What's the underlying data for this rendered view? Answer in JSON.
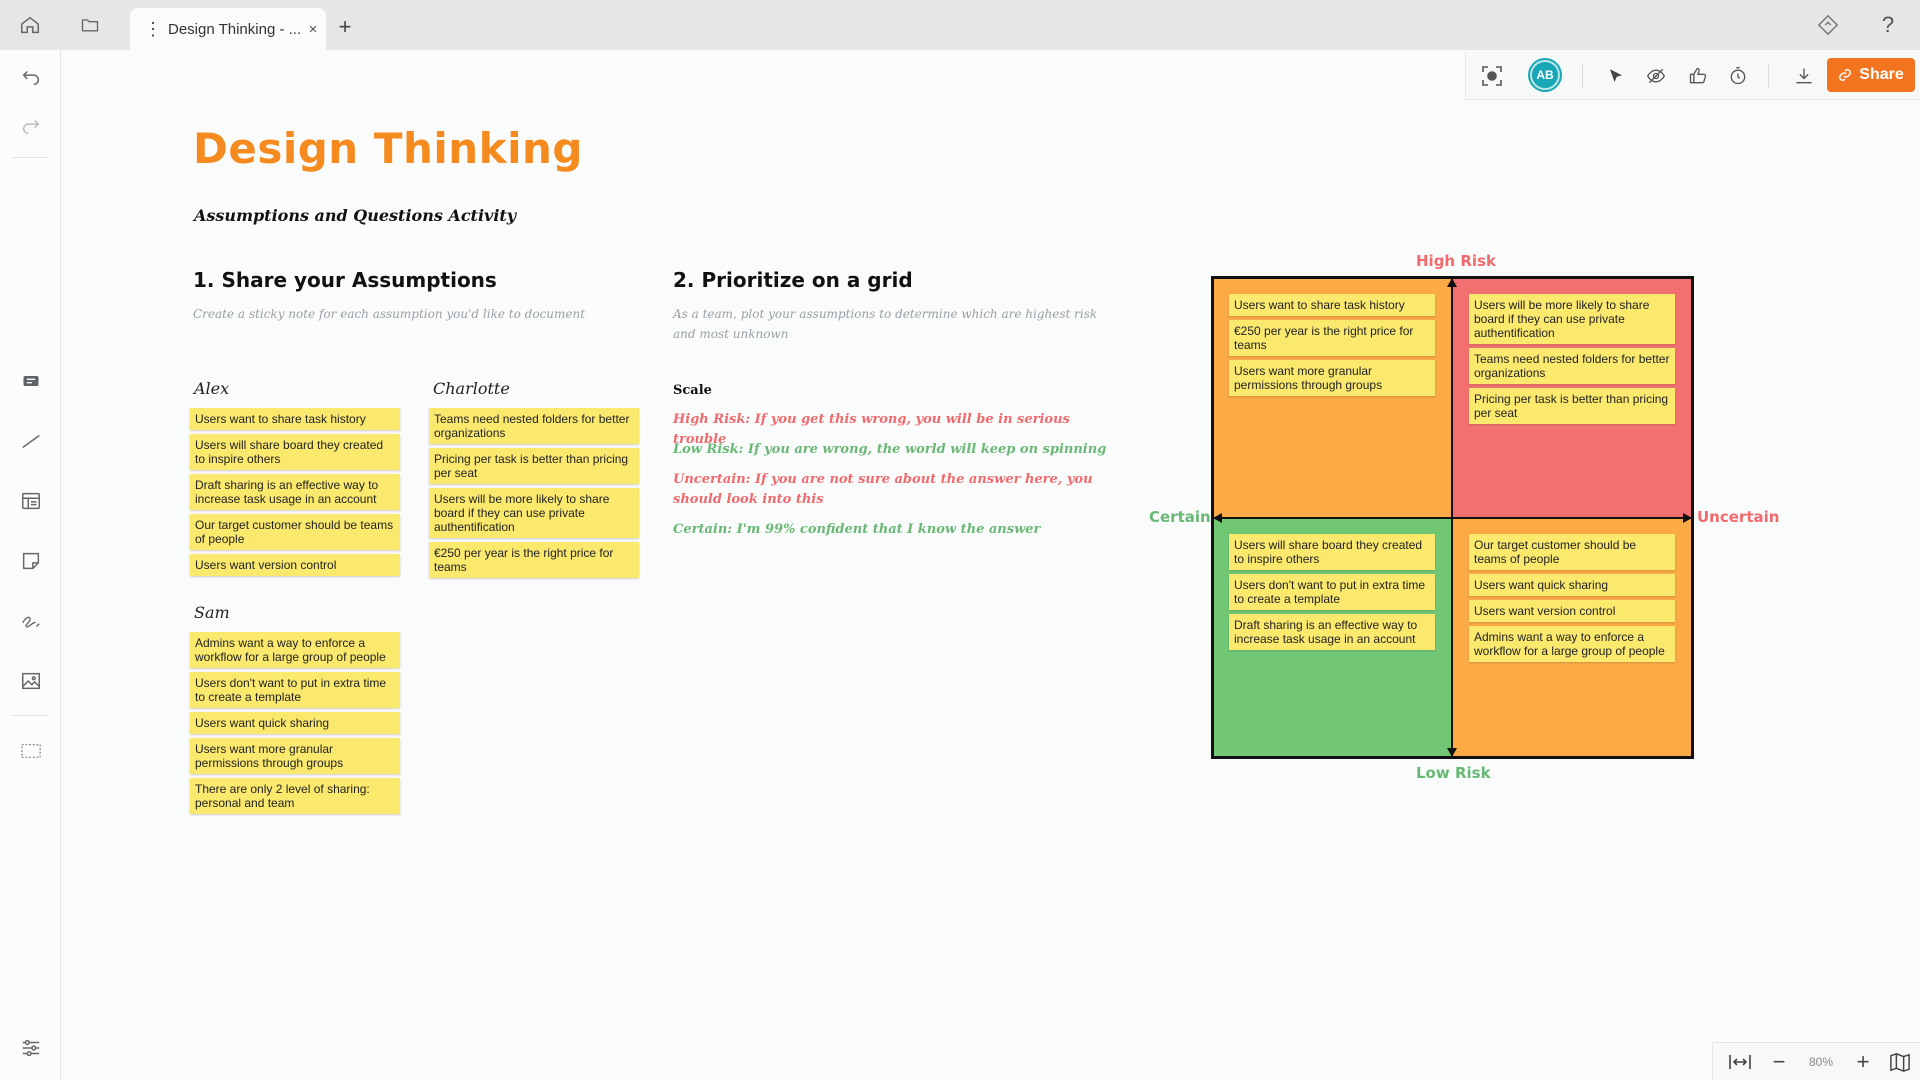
{
  "tab": {
    "title": "Design Thinking - ...",
    "close": "×",
    "new_tab": "+"
  },
  "toolbar": {
    "avatar_initials": "AB",
    "share_label": "Share"
  },
  "page": {
    "title": "Design Thinking",
    "subtitle": "Assumptions and Questions Activity"
  },
  "section1": {
    "title": "1. Share your Assumptions",
    "description": "Create a sticky note for each assumption you'd like to document"
  },
  "section2": {
    "title": "2. Prioritize on a grid",
    "description": "As a team, plot your assumptions to determine which are highest risk and most unknown"
  },
  "people": {
    "alex": {
      "name": "Alex",
      "notes": [
        "Users want to share task history",
        "Users will share board they created to inspire others",
        "Draft sharing is an effective way to increase task usage in an account",
        "Our target customer should be teams of people",
        "Users want version control"
      ]
    },
    "charlotte": {
      "name": "Charlotte",
      "notes": [
        "Teams need nested folders for better organizations",
        "Pricing per task is better than pricing per seat",
        "Users will be more likely to share board if they can use private authentification",
        "€250 per year is the right price for teams"
      ]
    },
    "sam": {
      "name": "Sam",
      "notes": [
        "Admins want a way to enforce a workflow for a large group of people",
        "Users don't want to put in extra time to create a template",
        "Users want quick sharing",
        "Users want more granular permissions through groups",
        "There are only 2 level of sharing: personal and team"
      ]
    }
  },
  "scale": {
    "label": "Scale",
    "high_risk": "High Risk: If you get this wrong, you will be in serious trouble",
    "low_risk": "Low Risk: If you are wrong, the world will keep on spinning",
    "uncertain": "Uncertain: If you are not sure about the answer here, you should look into this",
    "certain": "Certain: I'm 99% confident that I know the answer"
  },
  "grid": {
    "labels": {
      "top": "High Risk",
      "bottom": "Low Risk",
      "left": "Certain",
      "right": "Uncertain"
    },
    "colors": {
      "top_left": "#fbaa45",
      "top_right": "#f27170",
      "bottom_left": "#72c775",
      "bottom_right": "#fbaa45",
      "red_label": "#f06a6e",
      "green_label": "#6ab876"
    },
    "top_left": [
      "Users want to share task history",
      "€250 per year is the right price for teams",
      "Users want more granular permissions through groups"
    ],
    "top_right": [
      "Users will be more likely to share board if they can use private authentification",
      "Teams need nested folders for better organizations",
      "Pricing per task is better than pricing per seat"
    ],
    "bottom_left": [
      "Users will share board they created to inspire others",
      "Users don't want to put in extra time to create a template",
      "Draft sharing is an effective way to increase task usage in an account"
    ],
    "bottom_right": [
      "Our target customer should be teams of people",
      "Users want quick sharing",
      "Users want version control",
      "Admins want a way to enforce a workflow for a large group of people"
    ]
  },
  "zoom": {
    "level": "80%"
  }
}
